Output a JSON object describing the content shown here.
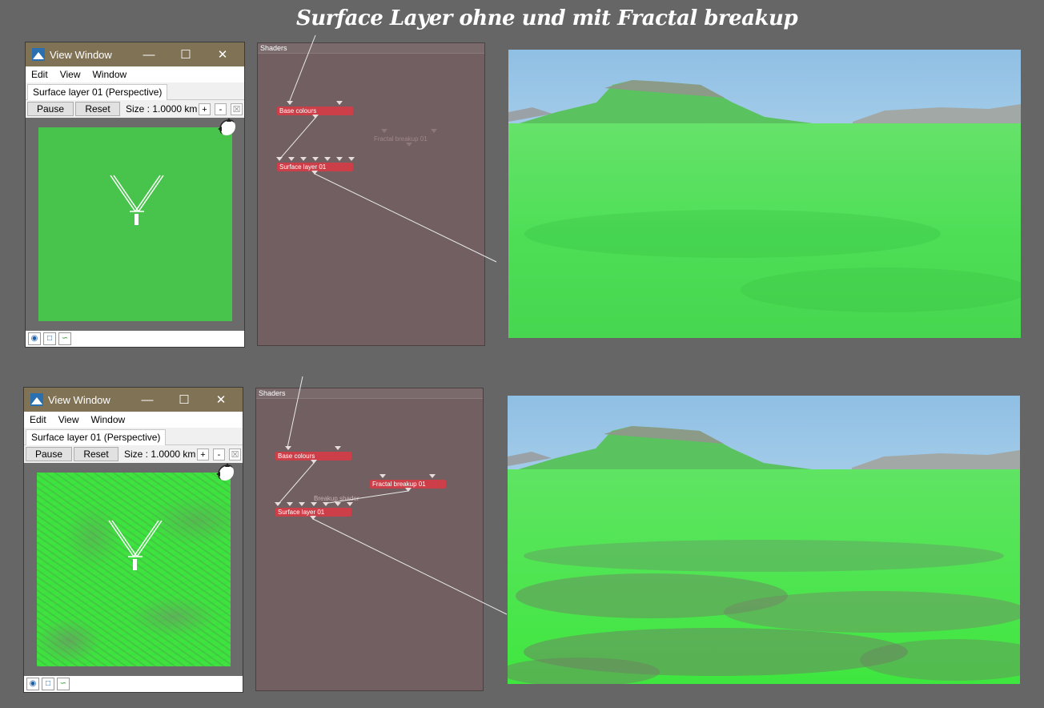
{
  "heading": "Surface Layer ohne und mit Fractal breakup",
  "panels": [
    {
      "view_window": {
        "title": "View Window",
        "menu": [
          "Edit",
          "View",
          "Window"
        ],
        "tab_label": "Surface layer 01 (Perspective)",
        "pause_label": "Pause",
        "reset_label": "Reset",
        "size_text": "Size : 1.0000 km",
        "zoom_in_label": "+",
        "zoom_out_label": "-"
      },
      "shaders": {
        "title": "Shaders",
        "nodes": {
          "base": "Base colours",
          "fractal": "Fractal breakup 01",
          "surface": "Surface layer 01"
        }
      }
    },
    {
      "view_window": {
        "title": "View Window",
        "menu": [
          "Edit",
          "View",
          "Window"
        ],
        "tab_label": "Surface layer 01 (Perspective)",
        "pause_label": "Pause",
        "reset_label": "Reset",
        "size_text": "Size : 1.0000 km",
        "zoom_in_label": "+",
        "zoom_out_label": "-"
      },
      "shaders": {
        "title": "Shaders",
        "nodes": {
          "base": "Base colours",
          "fractal": "Fractal breakup 01",
          "surface": "Surface layer 01"
        },
        "edge_label": "Breakup shader"
      }
    }
  ],
  "icons": {
    "app": "terragen-app-icon",
    "minimize": "minimize-icon",
    "maximize": "maximize-icon",
    "close": "close-icon",
    "compass": "compass-icon",
    "eye": "eye-icon",
    "frame": "frame-icon",
    "curve": "curve-icon"
  },
  "colors": {
    "background": "#666666",
    "titlebar": "#807255",
    "shader_panel": "#715f62",
    "node": "#cc3f48",
    "terrain_plain": "#48c44c",
    "terrain_rough": "#3fe23f"
  }
}
